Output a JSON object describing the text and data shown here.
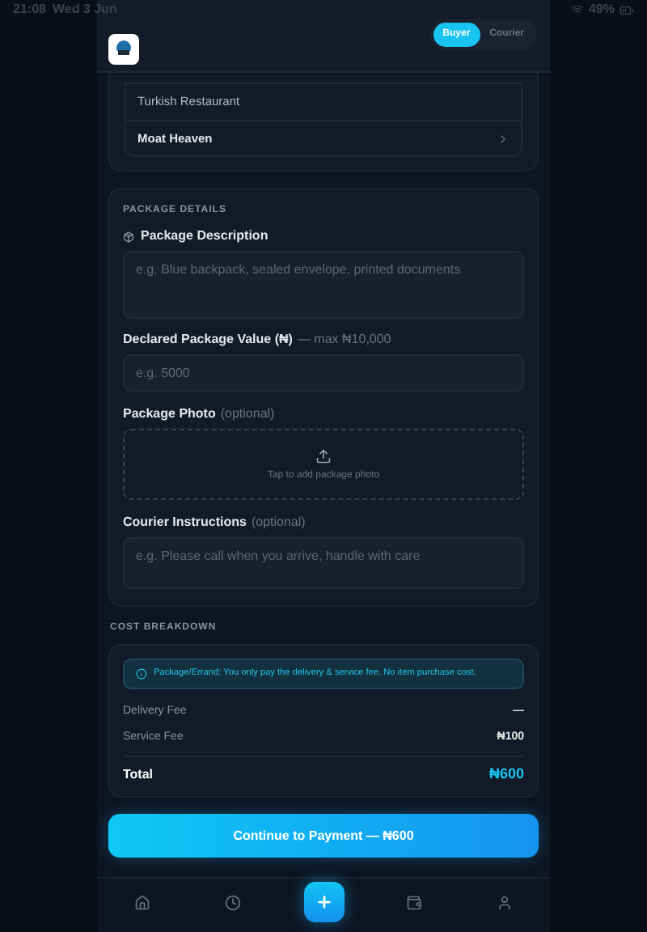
{
  "status_bar": {
    "time": "21:08",
    "date": "Wed 3 Jun",
    "battery": "49%"
  },
  "header": {
    "mode_tabs": [
      {
        "label": "Buyer",
        "selected": true
      },
      {
        "label": "Courier",
        "selected": false
      }
    ]
  },
  "restaurant_list": {
    "items": [
      {
        "label": "Turkish Restaurant",
        "bold": false,
        "chevron": false
      },
      {
        "label": "Moat Heaven",
        "bold": true,
        "chevron": true
      }
    ]
  },
  "package_details": {
    "heading": "PACKAGE DETAILS",
    "description": {
      "label": "Package Description",
      "placeholder": "e.g. Blue backpack, sealed envelope, printed documents"
    },
    "value": {
      "label": "Declared Package Value (₦)",
      "hint": "— max ₦10,000",
      "placeholder": "e.g. 5000"
    },
    "photo": {
      "label": "Package Photo",
      "hint": "(optional)",
      "prompt": "Tap to add package photo"
    },
    "instructions": {
      "label": "Courier Instructions",
      "hint": "(optional)",
      "placeholder": "e.g. Please call when you arrive, handle with care"
    }
  },
  "cost_breakdown": {
    "heading": "COST BREAKDOWN",
    "notice": "Package/Errand: You only pay the delivery & service fee. No item purchase cost.",
    "rows": [
      {
        "label": "Delivery Fee",
        "value": "—"
      },
      {
        "label": "Service Fee",
        "value": "₦100"
      }
    ],
    "total": {
      "label": "Total",
      "value": "₦600"
    }
  },
  "continue_button": "Continue to Payment — ₦600",
  "bottom_nav": [
    {
      "kind": "home"
    },
    {
      "kind": "history"
    },
    {
      "kind": "add"
    },
    {
      "kind": "wallet"
    },
    {
      "kind": "profile"
    }
  ]
}
